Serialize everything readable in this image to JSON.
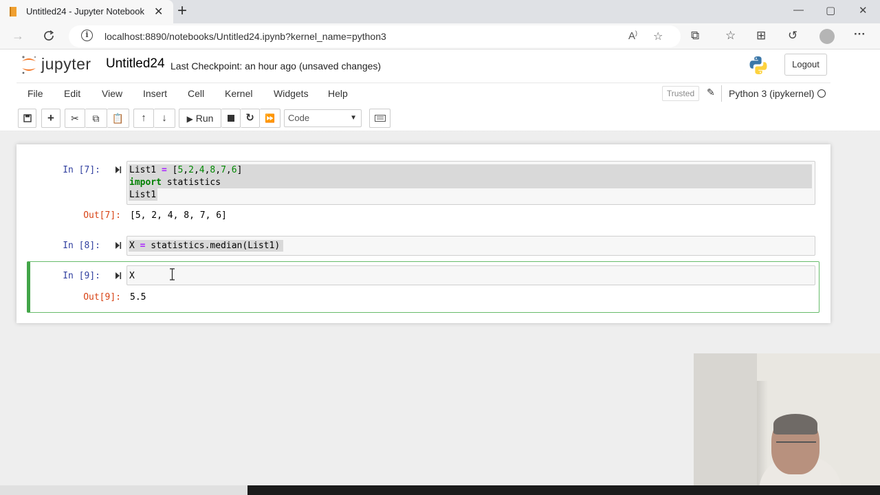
{
  "browser": {
    "tab_title": "Untitled24 - Jupyter Notebook",
    "tab_close_glyph": "✕",
    "new_tab_glyph": "+",
    "url": "localhost:8890/notebooks/Untitled24.ipynb?kernel_name=python3",
    "window_controls": [
      "—",
      "▢",
      "✕"
    ]
  },
  "header": {
    "logo_text": "jupyter",
    "notebook_name": "Untitled24",
    "checkpoint": "Last Checkpoint: an hour ago",
    "unsaved": "(unsaved changes)",
    "logout_label": "Logout"
  },
  "menubar": {
    "items": [
      "File",
      "Edit",
      "View",
      "Insert",
      "Cell",
      "Kernel",
      "Widgets",
      "Help"
    ],
    "trusted_label": "Trusted",
    "kernel_name": "Python 3 (ipykernel)"
  },
  "toolbar": {
    "run_label": "Run",
    "cell_type": "Code"
  },
  "cells": [
    {
      "in_prompt": "In [7]:",
      "lines": [
        "List1 = [5,2,4,8,7,6]",
        "import statistics",
        "List1"
      ],
      "out_prompt": "Out[7]:",
      "output": "[5, 2, 4, 8, 7, 6]"
    },
    {
      "in_prompt": "In [8]:",
      "lines": [
        "X = statistics.median(List1)"
      ]
    },
    {
      "in_prompt": "In [9]:",
      "lines": [
        "X"
      ],
      "out_prompt": "Out[9]:",
      "output": "5.5"
    }
  ],
  "colors": {
    "prompt_in": "#303f9f",
    "prompt_out": "#d84315",
    "selected_cell_border": "#42a548",
    "keyword": "#008000",
    "number": "#008800"
  }
}
